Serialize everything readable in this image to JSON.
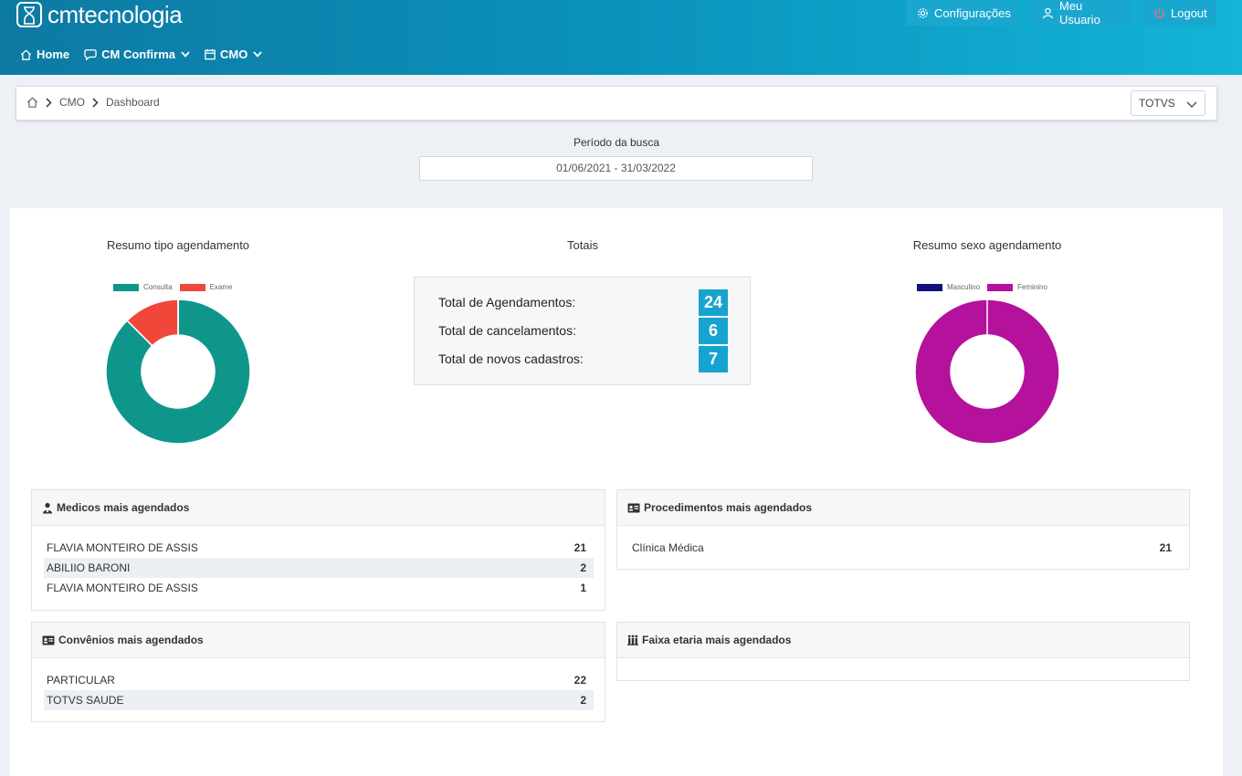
{
  "app": {
    "logo_text": "cmtecnologia",
    "top_buttons": {
      "config_label": "Configurações",
      "user_label": "Meu Usuario",
      "logout_label": "Logout"
    },
    "nav": {
      "home_label": "Home",
      "cm_confirma_label": "CM Confirma",
      "cmo_label": "CMO"
    }
  },
  "breadcrumb": {
    "item1": "CMO",
    "item2": "Dashboard"
  },
  "company_select": {
    "value": "TOTVS"
  },
  "period": {
    "label": "Período da busca",
    "value": "01/06/2021 - 31/03/2022"
  },
  "sections": {
    "tipo_title": "Resumo tipo agendamento",
    "totais_title": "Totais",
    "sexo_title": "Resumo sexo agendamento"
  },
  "chart_data": [
    {
      "type": "pie",
      "title": "Resumo tipo agendamento",
      "labels": [
        "Consulta",
        "Exame"
      ],
      "values": [
        21,
        3
      ],
      "colors": [
        "#0f968a",
        "#f0473a"
      ],
      "legend": "top"
    },
    {
      "type": "pie",
      "title": "Resumo sexo agendamento",
      "labels": [
        "Masculino",
        "Feminino"
      ],
      "values": [
        0,
        24
      ],
      "colors": [
        "#131080",
        "#b4119c"
      ],
      "legend": "top"
    }
  ],
  "totais": {
    "agendamentos_label": "Total de Agendamentos:",
    "agendamentos_value": "24",
    "cancelamentos_label": "Total de cancelamentos:",
    "cancelamentos_value": "6",
    "cadastros_label": "Total de novos cadastros:",
    "cadastros_value": "7"
  },
  "medicos": {
    "title": "Medicos mais agendados",
    "rows": [
      {
        "name": "FLAVIA MONTEIRO DE ASSIS",
        "count": "21"
      },
      {
        "name": "ABILIIO BARONI",
        "count": "2"
      },
      {
        "name": "FLAVIA MONTEIRO DE ASSIS",
        "count": "1"
      }
    ]
  },
  "procedimentos": {
    "title": "Procedimentos mais agendados",
    "rows": [
      {
        "name": "Clínica Médica",
        "count": "21"
      }
    ]
  },
  "convenios": {
    "title": "Convênios mais agendados",
    "rows": [
      {
        "name": "PARTICULAR",
        "count": "22"
      },
      {
        "name": "TOTVS SAUDE",
        "count": "2"
      }
    ]
  },
  "faixa": {
    "title": "Faixa etaria mais agendados"
  },
  "icons": {
    "logo": "hourglass-icon",
    "config": "gear-icon",
    "user": "user-icon",
    "logout": "power-icon",
    "home": "home-icon",
    "cm_confirma": "chat-icon",
    "cmo": "calendar-icon",
    "medicos": "doctor-icon",
    "procedimentos": "id-card-icon",
    "convenios": "id-card-icon",
    "faixa": "people-icon"
  }
}
